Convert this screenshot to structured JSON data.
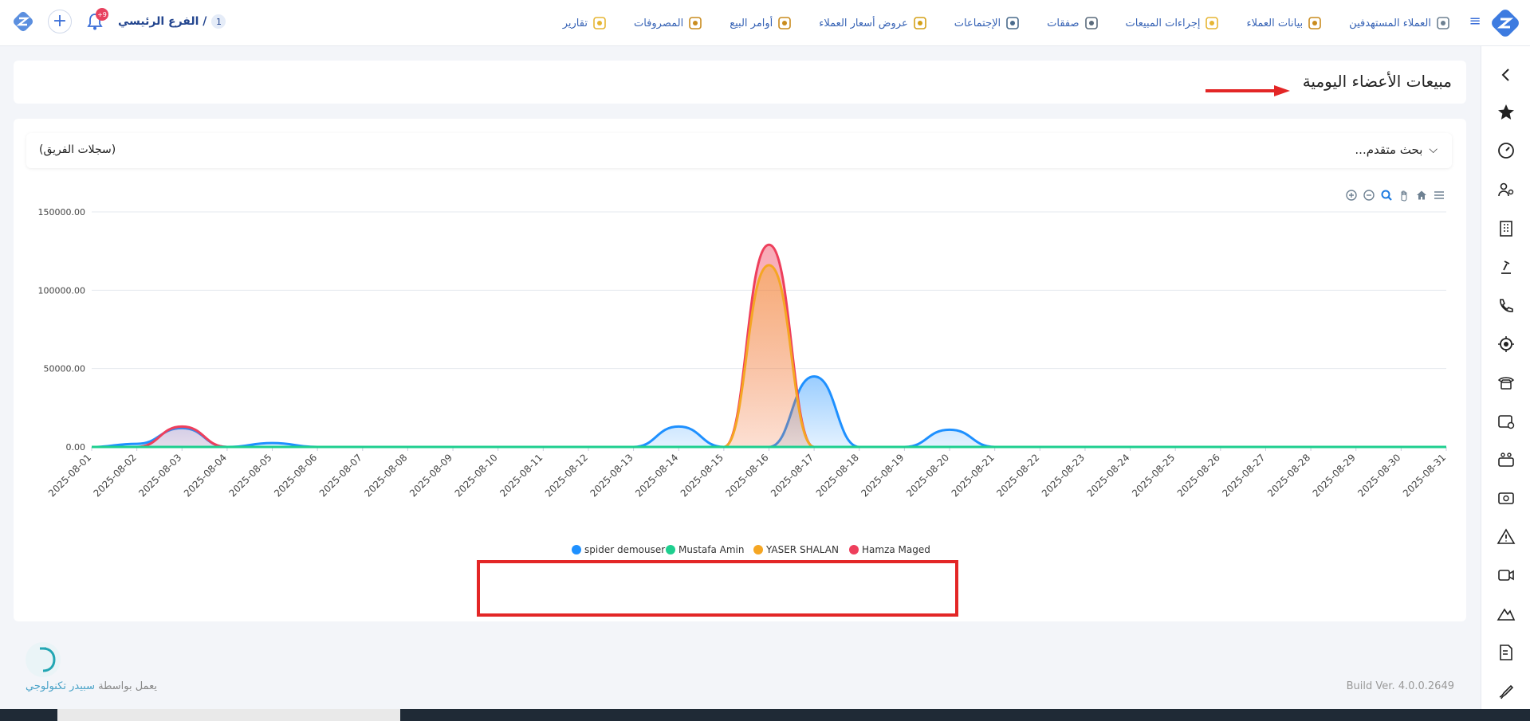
{
  "header": {
    "branch_name": "الفرع الرئيسي /",
    "branch_number": "1",
    "notifications_badge": "+9",
    "nav": [
      {
        "label": "العملاء المستهدفين",
        "icon": "users-target-icon"
      },
      {
        "label": "بيانات العملاء",
        "icon": "contact-data-icon"
      },
      {
        "label": "إجراءات المبيعات",
        "icon": "award-icon"
      },
      {
        "label": "صفقات",
        "icon": "org-chart-icon"
      },
      {
        "label": "الإجتماعات",
        "icon": "presentation-icon"
      },
      {
        "label": "عروض أسعار العملاء",
        "icon": "quote-icon"
      },
      {
        "label": "أوامر البيع",
        "icon": "money-bag-icon"
      },
      {
        "label": "المصروفات",
        "icon": "laptop-icon"
      },
      {
        "label": "تقارير",
        "icon": "report-circle-icon"
      }
    ]
  },
  "page": {
    "title": "مبيعات الأعضاء اليومية",
    "advanced_search": "بحث متقدم...",
    "team_log": "(سجلات الفريق)"
  },
  "chart_data": {
    "type": "area",
    "title": "",
    "xlabel": "",
    "ylabel": "",
    "ylim": [
      0,
      150000
    ],
    "yticks": [
      "0.00",
      "50000.00",
      "100000.00",
      "150000.00"
    ],
    "x": [
      "2025-08-01",
      "2025-08-02",
      "2025-08-03",
      "2025-08-04",
      "2025-08-05",
      "2025-08-06",
      "2025-08-07",
      "2025-08-08",
      "2025-08-09",
      "2025-08-10",
      "2025-08-11",
      "2025-08-12",
      "2025-08-13",
      "2025-08-14",
      "2025-08-15",
      "2025-08-16",
      "2025-08-17",
      "2025-08-18",
      "2025-08-19",
      "2025-08-20",
      "2025-08-21",
      "2025-08-22",
      "2025-08-23",
      "2025-08-24",
      "2025-08-25",
      "2025-08-26",
      "2025-08-27",
      "2025-08-28",
      "2025-08-29",
      "2025-08-30",
      "2025-08-31"
    ],
    "legend_position": "bottom",
    "series": [
      {
        "name": "spider demouser",
        "color": "#1e90ff",
        "values": [
          0,
          2000,
          12000,
          0,
          2500,
          0,
          0,
          0,
          0,
          0,
          0,
          0,
          0,
          13000,
          0,
          0,
          45000,
          0,
          0,
          11000,
          0,
          0,
          0,
          0,
          0,
          0,
          0,
          0,
          0,
          0,
          0
        ]
      },
      {
        "name": "Mustafa Amin",
        "color": "#1ecf8f",
        "values": [
          0,
          0,
          0,
          0,
          0,
          0,
          0,
          0,
          0,
          0,
          0,
          0,
          0,
          0,
          0,
          0,
          0,
          0,
          0,
          0,
          0,
          0,
          0,
          0,
          0,
          0,
          0,
          0,
          0,
          0,
          0
        ]
      },
      {
        "name": "YASER SHALAN",
        "color": "#f5a623",
        "values": [
          0,
          0,
          0,
          0,
          0,
          0,
          0,
          0,
          0,
          0,
          0,
          0,
          0,
          0,
          0,
          116000,
          0,
          0,
          0,
          0,
          0,
          0,
          0,
          0,
          0,
          0,
          0,
          0,
          0,
          0,
          0
        ]
      },
      {
        "name": "Hamza Maged",
        "color": "#ee3f5c",
        "values": [
          0,
          0,
          13000,
          0,
          0,
          0,
          0,
          0,
          0,
          0,
          0,
          0,
          0,
          0,
          0,
          129000,
          0,
          0,
          0,
          0,
          0,
          0,
          0,
          0,
          0,
          0,
          0,
          0,
          0,
          0,
          0
        ]
      }
    ]
  },
  "footer": {
    "build": "Build Ver. 4.0.0.2649",
    "powered_prefix": "يعمل بواسطة",
    "powered_brand": "سبيدر تكنولوجي"
  }
}
